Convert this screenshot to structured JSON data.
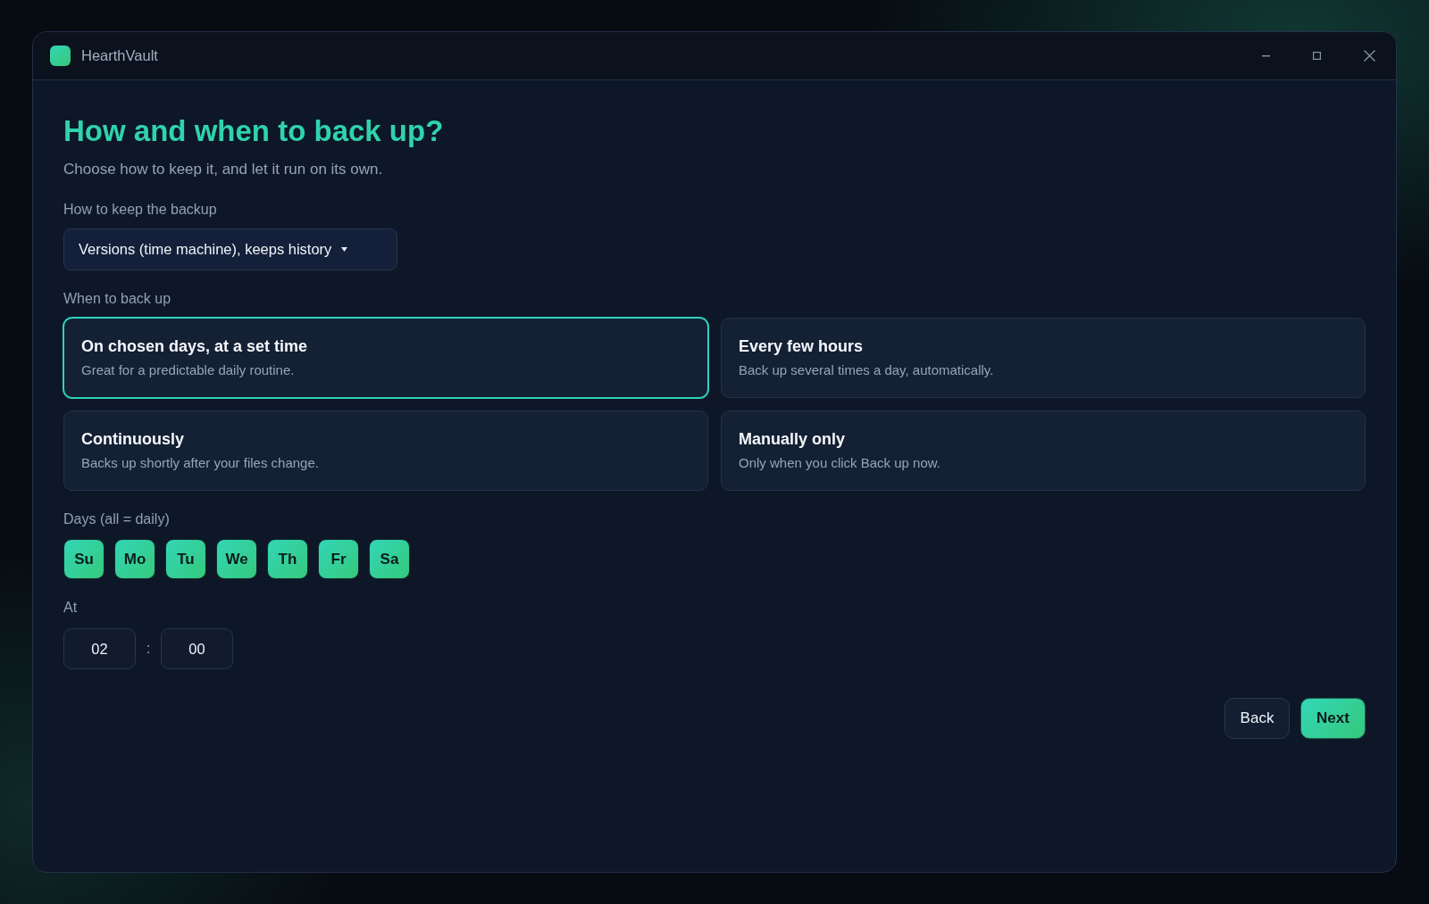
{
  "window": {
    "title": "HearthVault"
  },
  "heading": "How and when to back up?",
  "subtitle": "Choose how to keep it, and let it run on its own.",
  "storage": {
    "label": "How to keep the backup",
    "value": "Versions (time machine), keeps history"
  },
  "schedule": {
    "label": "When to back up",
    "options": [
      {
        "title": "On chosen days, at a set time",
        "description": "Great for a predictable daily routine.",
        "selected": true
      },
      {
        "title": "Every few hours",
        "description": "Back up several times a day, automatically.",
        "selected": false
      },
      {
        "title": "Continuously",
        "description": "Backs up shortly after your files change.",
        "selected": false
      },
      {
        "title": "Manually only",
        "description": "Only when you click Back up now.",
        "selected": false
      }
    ]
  },
  "days": {
    "label": "Days (all = daily)",
    "items": [
      {
        "label": "Su",
        "selected": true
      },
      {
        "label": "Mo",
        "selected": true
      },
      {
        "label": "Tu",
        "selected": true
      },
      {
        "label": "We",
        "selected": true
      },
      {
        "label": "Th",
        "selected": true
      },
      {
        "label": "Fr",
        "selected": true
      },
      {
        "label": "Sa",
        "selected": true
      }
    ]
  },
  "time": {
    "label": "At",
    "hour": "02",
    "separator": ":",
    "minute": "00"
  },
  "buttons": [
    {
      "label": "Back",
      "kind": "secondary"
    },
    {
      "label": "Next",
      "kind": "primary"
    }
  ]
}
